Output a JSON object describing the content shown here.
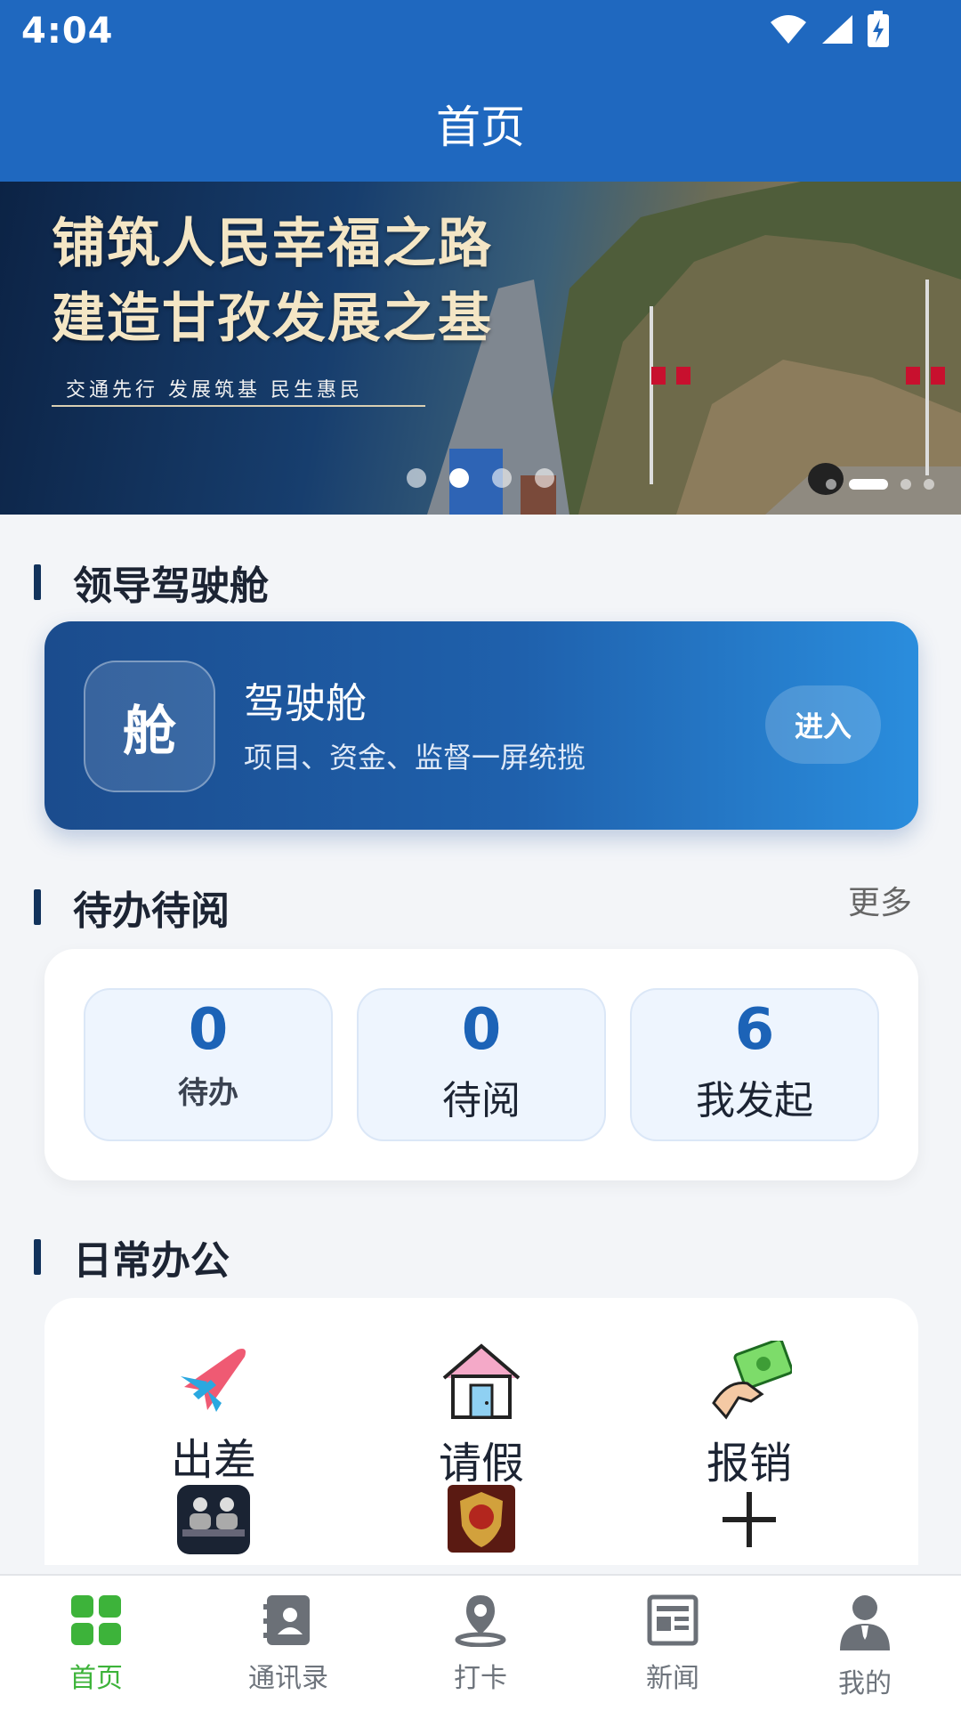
{
  "status_bar": {
    "time": "4:04"
  },
  "app_bar": {
    "title": "首页"
  },
  "banner": {
    "line1": "铺筑人民幸福之路",
    "line2": "建造甘孜发展之基",
    "subtitle": "交通先行  发展筑基  民生惠民"
  },
  "cockpit_section": {
    "title": "领导驾驶舱",
    "card": {
      "icon_text": "舱",
      "title": "驾驶舱",
      "subtitle": "项目、资金、监督一屏统揽",
      "button": "进入"
    }
  },
  "todo_section": {
    "title": "待办待阅",
    "more": "更多",
    "items": [
      {
        "count": "0",
        "label": "待办"
      },
      {
        "count": "0",
        "label": "待阅"
      },
      {
        "count": "6",
        "label": "我发起"
      }
    ]
  },
  "office_section": {
    "title": "日常办公",
    "items": [
      {
        "label": "出差",
        "icon": "airplane-icon"
      },
      {
        "label": "请假",
        "icon": "house-icon"
      },
      {
        "label": "报销",
        "icon": "money-hand-icon"
      },
      {
        "label": "",
        "icon": "meeting-icon"
      },
      {
        "label": "",
        "icon": "badge-icon"
      },
      {
        "label": "",
        "icon": "add-icon"
      }
    ]
  },
  "bottom_nav": {
    "items": [
      {
        "label": "首页",
        "icon": "grid-icon",
        "active": true
      },
      {
        "label": "通讯录",
        "icon": "contacts-icon",
        "active": false
      },
      {
        "label": "打卡",
        "icon": "location-pin-icon",
        "active": false
      },
      {
        "label": "新闻",
        "icon": "news-icon",
        "active": false
      },
      {
        "label": "我的",
        "icon": "user-icon",
        "active": false
      }
    ]
  },
  "colors": {
    "primary": "#1f68bf",
    "active_nav": "#3db33a"
  }
}
